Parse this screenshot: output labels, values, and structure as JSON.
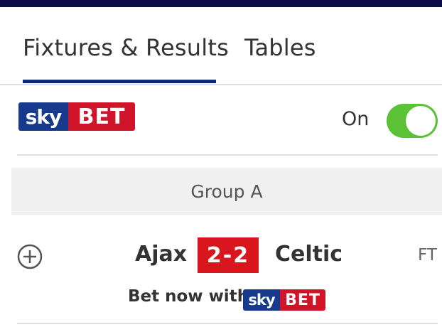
{
  "tabs": {
    "fixtures_label": "Fixtures & Results",
    "tables_label": "Tables",
    "active": "Fixtures & Results"
  },
  "sponsor": {
    "logo_sky": "sky",
    "logo_bet": "BET",
    "toggle_label": "On",
    "toggle_on": true
  },
  "group": {
    "name": "Group A"
  },
  "match": {
    "home": "Ajax",
    "score": "2-2",
    "away": "Celtic",
    "status": "FT",
    "bet_text": "Bet now with"
  },
  "icons": {
    "expand": "plus-circle-icon"
  },
  "colors": {
    "top_bar": "#0b0b4a",
    "tab_underline": "#0b2a78",
    "skybet_blue": "#173a8c",
    "skybet_red": "#d0152a",
    "toggle_green": "#5bc236",
    "score_red": "#d7161e"
  }
}
